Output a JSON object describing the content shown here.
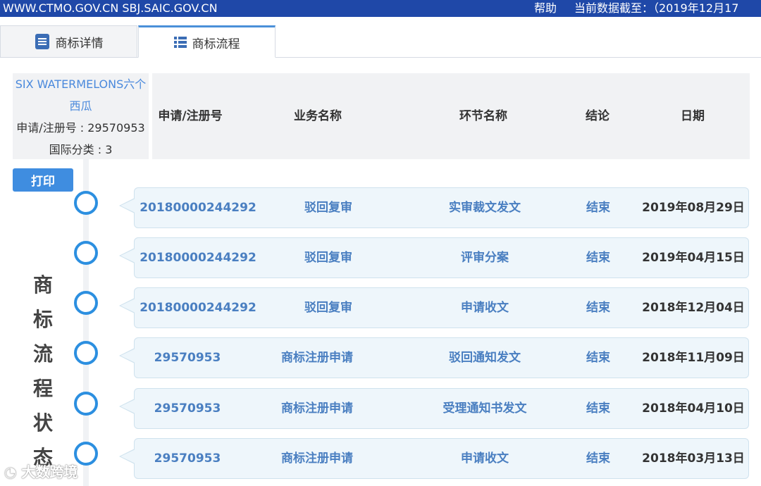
{
  "topbar": {
    "site": "WWW.CTMO.GOV.CN SBJ.SAIC.GOV.CN",
    "help": "帮助",
    "as_of": "当前数据截至：（2019年12月17"
  },
  "tabs": [
    {
      "label": "商标详情",
      "icon": "document-icon"
    },
    {
      "label": "商标流程",
      "icon": "list-icon"
    }
  ],
  "trademark": {
    "name": "SIX WATERMELONS六个西瓜",
    "reg_no_label": "申请/注册号 : 29570953",
    "class_label": "国际分类 : 3"
  },
  "columns": [
    "申请/注册号",
    "业务名称",
    "环节名称",
    "结论",
    "日期"
  ],
  "print_label": "打印",
  "timeline_title": "商标流程状态",
  "rows": [
    {
      "no": "20180000244292",
      "business": "驳回复审",
      "stage": "实审裁文发文",
      "result": "结束",
      "date": "2019年08月29日"
    },
    {
      "no": "20180000244292",
      "business": "驳回复审",
      "stage": "评审分案",
      "result": "结束",
      "date": "2019年04月15日"
    },
    {
      "no": "20180000244292",
      "business": "驳回复审",
      "stage": "申请收文",
      "result": "结束",
      "date": "2018年12月04日"
    },
    {
      "no": "29570953",
      "business": "商标注册申请",
      "stage": "驳回通知发文",
      "result": "结束",
      "date": "2018年11月09日"
    },
    {
      "no": "29570953",
      "business": "商标注册申请",
      "stage": "受理通知书发文",
      "result": "结束",
      "date": "2018年04月10日"
    },
    {
      "no": "29570953",
      "business": "商标注册申请",
      "stage": "申请收文",
      "result": "结束",
      "date": "2018年03月13日"
    }
  ],
  "watermark": "大数跨境",
  "colors": {
    "topbar": "#1f48a8",
    "accent": "#3f8de0",
    "link": "#4a7fc1",
    "row_bg": "#eef6fb"
  }
}
